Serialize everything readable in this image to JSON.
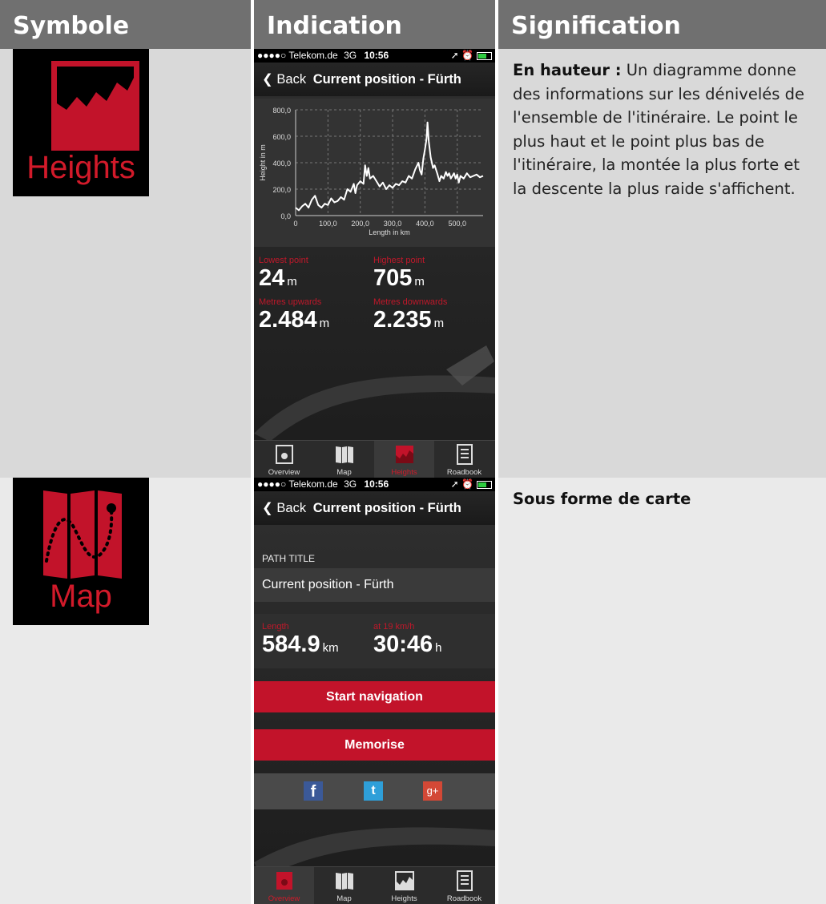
{
  "headers": {
    "symbole": "Symbole",
    "indication": "Indication",
    "signification": "Signification"
  },
  "colors": {
    "header_bg": "#707070",
    "row_light": "#d9d9d9",
    "row_lighter": "#eaeaea",
    "brand_red": "#d21a2a"
  },
  "rows": [
    {
      "symbol": {
        "icon": "heights-icon",
        "label": "Heights"
      },
      "description_bold": "En hauteur :",
      "description_text": " Un diagramme donne des informations sur les dénivelés de l'ensemble de l'itinéraire. Le point le plus haut et le point plus bas de l'itinéraire, la montée la plus forte et la descente la plus raide s'affichent."
    },
    {
      "symbol": {
        "icon": "map-icon",
        "label": "Map"
      },
      "description_bold": "Sous forme de carte",
      "description_text": ""
    }
  ],
  "phone": {
    "status": {
      "carrier": "●●●●○ Telekom.de",
      "network": "3G",
      "time": "10:56",
      "icons": "➚ ⏰"
    },
    "nav": {
      "back": "❮ Back",
      "title": "Current position - Fürth"
    },
    "tabs": [
      "Overview",
      "Map",
      "Heights",
      "Roadbook"
    ]
  },
  "heights_screen": {
    "stats": {
      "lowest_label": "Lowest point",
      "lowest_value": "24",
      "lowest_unit": "m",
      "highest_label": "Highest point",
      "highest_value": "705",
      "highest_unit": "m",
      "up_label": "Metres upwards",
      "up_value": "2.484",
      "up_unit": "m",
      "down_label": "Metres downwards",
      "down_value": "2.235",
      "down_unit": "m"
    }
  },
  "chart_data": {
    "type": "line",
    "title": "",
    "xlabel": "Length in km",
    "ylabel": "Height in m",
    "xlim": [
      0,
      580
    ],
    "ylim": [
      0,
      800
    ],
    "x_ticks": [
      "0",
      "100,0",
      "200,0",
      "300,0",
      "400,0",
      "500,0"
    ],
    "y_ticks": [
      "0,0",
      "200,0",
      "400,0",
      "600,0",
      "800,0"
    ],
    "grid": true,
    "series": [
      {
        "values": [
          [
            0,
            60
          ],
          [
            10,
            40
          ],
          [
            20,
            70
          ],
          [
            30,
            90
          ],
          [
            40,
            60
          ],
          [
            50,
            120
          ],
          [
            60,
            150
          ],
          [
            70,
            80
          ],
          [
            80,
            60
          ],
          [
            90,
            90
          ],
          [
            100,
            80
          ],
          [
            110,
            130
          ],
          [
            120,
            100
          ],
          [
            130,
            110
          ],
          [
            140,
            140
          ],
          [
            150,
            120
          ],
          [
            160,
            200
          ],
          [
            170,
            180
          ],
          [
            180,
            240
          ],
          [
            185,
            170
          ],
          [
            190,
            230
          ],
          [
            200,
            260
          ],
          [
            210,
            240
          ],
          [
            215,
            380
          ],
          [
            220,
            300
          ],
          [
            225,
            360
          ],
          [
            230,
            280
          ],
          [
            240,
            300
          ],
          [
            250,
            260
          ],
          [
            260,
            220
          ],
          [
            270,
            250
          ],
          [
            280,
            200
          ],
          [
            290,
            230
          ],
          [
            300,
            210
          ],
          [
            310,
            240
          ],
          [
            320,
            230
          ],
          [
            330,
            260
          ],
          [
            340,
            250
          ],
          [
            350,
            300
          ],
          [
            360,
            280
          ],
          [
            370,
            350
          ],
          [
            380,
            400
          ],
          [
            385,
            340
          ],
          [
            390,
            310
          ],
          [
            395,
            430
          ],
          [
            400,
            500
          ],
          [
            405,
            580
          ],
          [
            408,
            705
          ],
          [
            412,
            560
          ],
          [
            418,
            440
          ],
          [
            425,
            360
          ],
          [
            430,
            380
          ],
          [
            438,
            320
          ],
          [
            445,
            260
          ],
          [
            450,
            300
          ],
          [
            458,
            280
          ],
          [
            465,
            330
          ],
          [
            470,
            300
          ],
          [
            475,
            320
          ],
          [
            480,
            280
          ],
          [
            485,
            300
          ],
          [
            490,
            320
          ],
          [
            495,
            280
          ],
          [
            500,
            310
          ],
          [
            505,
            250
          ],
          [
            510,
            300
          ],
          [
            520,
            280
          ],
          [
            530,
            320
          ],
          [
            540,
            290
          ],
          [
            550,
            300
          ],
          [
            560,
            310
          ],
          [
            570,
            290
          ],
          [
            580,
            300
          ]
        ]
      }
    ]
  },
  "map_screen": {
    "path_title_label": "PATH TITLE",
    "path_title_value": "Current position - Fürth",
    "length_label": "Length",
    "length_value": "584.9",
    "length_unit": "km",
    "speed_label": "at 19 km/h",
    "time_value": "30:46",
    "time_unit": "h",
    "start_button": "Start navigation",
    "memorise_button": "Memorise",
    "social": [
      "f",
      "t",
      "g+"
    ]
  }
}
